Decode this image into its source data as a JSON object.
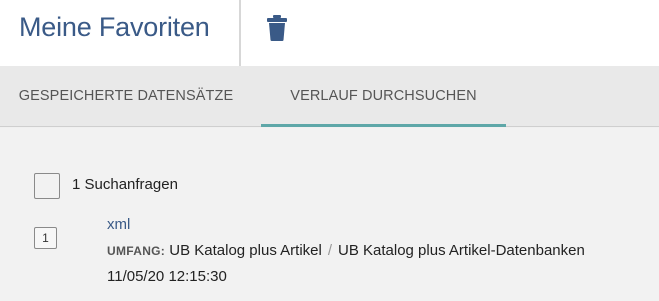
{
  "header": {
    "title": "Meine Favoriten",
    "delete_icon": "trash-icon",
    "accent_color": "#3a5a87"
  },
  "tabs": [
    {
      "label": "GESPEICHERTE DATENSÄTZE",
      "active": false
    },
    {
      "label": "VERLAUF DURCHSUCHEN",
      "active": true
    }
  ],
  "tab_accent_color": "#5ea7a8",
  "history": {
    "count_label": "1 Suchanfragen",
    "items": [
      {
        "index": "1",
        "query": "xml",
        "scope_label": "UMFANG:",
        "scope_primary": "UB Katalog plus Artikel",
        "scope_separator": "/",
        "scope_secondary": "UB Katalog plus Artikel-Datenbanken",
        "timestamp": "11/05/20 12:15:30"
      }
    ]
  }
}
